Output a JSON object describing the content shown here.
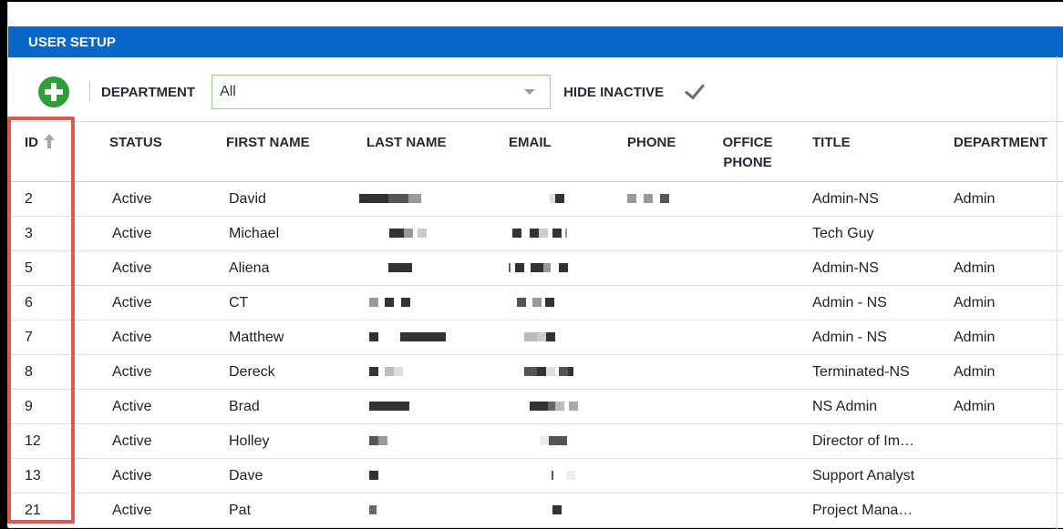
{
  "header": {
    "title": "USER SETUP"
  },
  "toolbar": {
    "add_icon": "plus-circle-icon",
    "department_label": "DEPARTMENT",
    "department_value": "All",
    "hide_inactive_label": "HIDE INACTIVE",
    "hide_inactive_checked": true
  },
  "colors": {
    "title_bar": "#0a66c9",
    "add_button": "#2f9e38",
    "highlight_box": "#e2574c",
    "select_border": "#9ccf8f"
  },
  "table": {
    "columns": [
      "ID",
      "STATUS",
      "FIRST NAME",
      "LAST NAME",
      "EMAIL",
      "PHONE",
      "OFFICE PHONE",
      "TITLE",
      "DEPARTMENT"
    ],
    "sorted_column": "ID",
    "sort_direction": "ascending",
    "rows": [
      {
        "id": "2",
        "status": "Active",
        "first_name": "David",
        "title": "Admin-NS",
        "department": "Admin"
      },
      {
        "id": "3",
        "status": "Active",
        "first_name": "Michael",
        "title": "Tech Guy",
        "department": ""
      },
      {
        "id": "5",
        "status": "Active",
        "first_name": "Aliena",
        "title": "Admin-NS",
        "department": "Admin"
      },
      {
        "id": "6",
        "status": "Active",
        "first_name": "CT",
        "title": "Admin - NS",
        "department": "Admin"
      },
      {
        "id": "7",
        "status": "Active",
        "first_name": "Matthew",
        "title": "Admin - NS",
        "department": "Admin"
      },
      {
        "id": "8",
        "status": "Active",
        "first_name": "Dereck",
        "title": "Terminated-NS",
        "department": "Admin"
      },
      {
        "id": "9",
        "status": "Active",
        "first_name": "Brad",
        "title": "NS Admin",
        "department": "Admin"
      },
      {
        "id": "12",
        "status": "Active",
        "first_name": "Holley",
        "title": "Director of Im…",
        "department": ""
      },
      {
        "id": "13",
        "status": "Active",
        "first_name": "Dave",
        "title": "Support Analyst",
        "department": ""
      },
      {
        "id": "21",
        "status": "Active",
        "first_name": "Pat",
        "title": "Project Mana…",
        "department": ""
      }
    ]
  }
}
